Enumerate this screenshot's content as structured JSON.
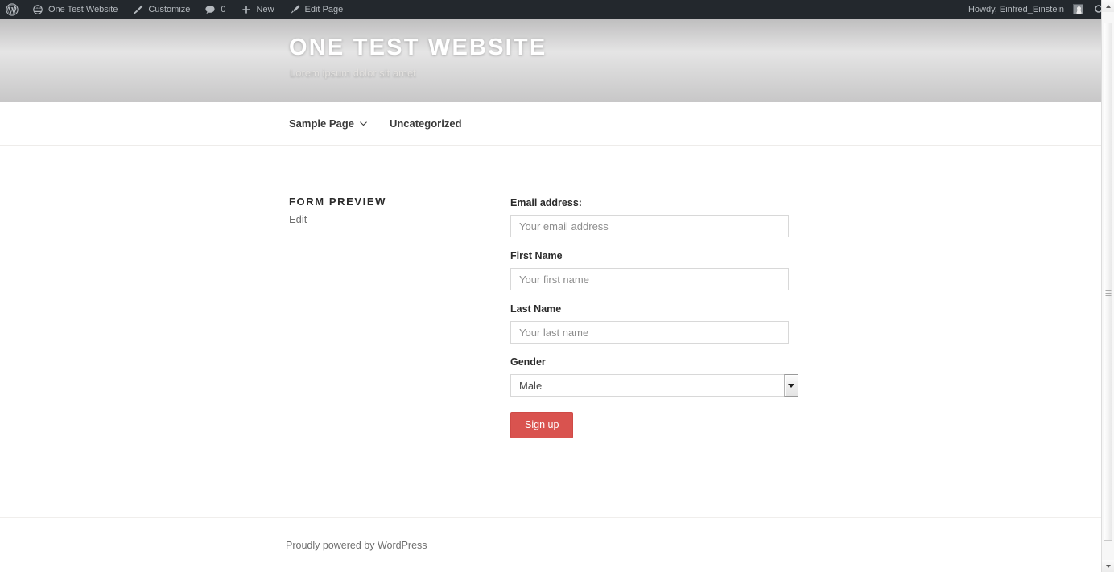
{
  "adminbar": {
    "logo_icon": "wordpress-logo-icon",
    "site_name": "One Test Website",
    "site_icon": "dashboard-home-icon",
    "customize_label": "Customize",
    "customize_icon": "paintbrush-icon",
    "comments_icon": "comment-bubble-icon",
    "comments_count": "0",
    "new_label": "New",
    "new_icon": "plus-icon",
    "edit_page_label": "Edit Page",
    "edit_page_icon": "pencil-icon",
    "howdy": "Howdy, Einfred_Einstein",
    "avatar_icon": "user-avatar",
    "search_icon": "search-icon",
    "background_color": "#23282d"
  },
  "header": {
    "title": "ONE TEST WEBSITE",
    "tagline": "Lorem ipsum dolor sit amet"
  },
  "nav": {
    "items": [
      {
        "label": "Sample Page",
        "has_submenu": true,
        "chevron_icon": "chevron-down-icon"
      },
      {
        "label": "Uncategorized",
        "has_submenu": false
      }
    ]
  },
  "entry": {
    "title": "FORM PREVIEW",
    "edit_label": "Edit"
  },
  "form": {
    "fields": [
      {
        "label": "Email address:",
        "placeholder": "Your email address",
        "value": "",
        "type": "email"
      },
      {
        "label": "First Name",
        "placeholder": "Your first name",
        "value": "",
        "type": "text"
      },
      {
        "label": "Last Name",
        "placeholder": "Your last name",
        "value": "",
        "type": "text"
      }
    ],
    "gender": {
      "label": "Gender",
      "selected": "Male",
      "dropdown_icon": "triangle-down-icon"
    },
    "submit_label": "Sign up",
    "submit_color": "#d9534f"
  },
  "footer": {
    "text_prefix": "Proudly powered by ",
    "link_label": "WordPress"
  },
  "scrollbar": {
    "up_icon": "scroll-up-arrow-icon",
    "down_icon": "scroll-down-arrow-icon"
  }
}
